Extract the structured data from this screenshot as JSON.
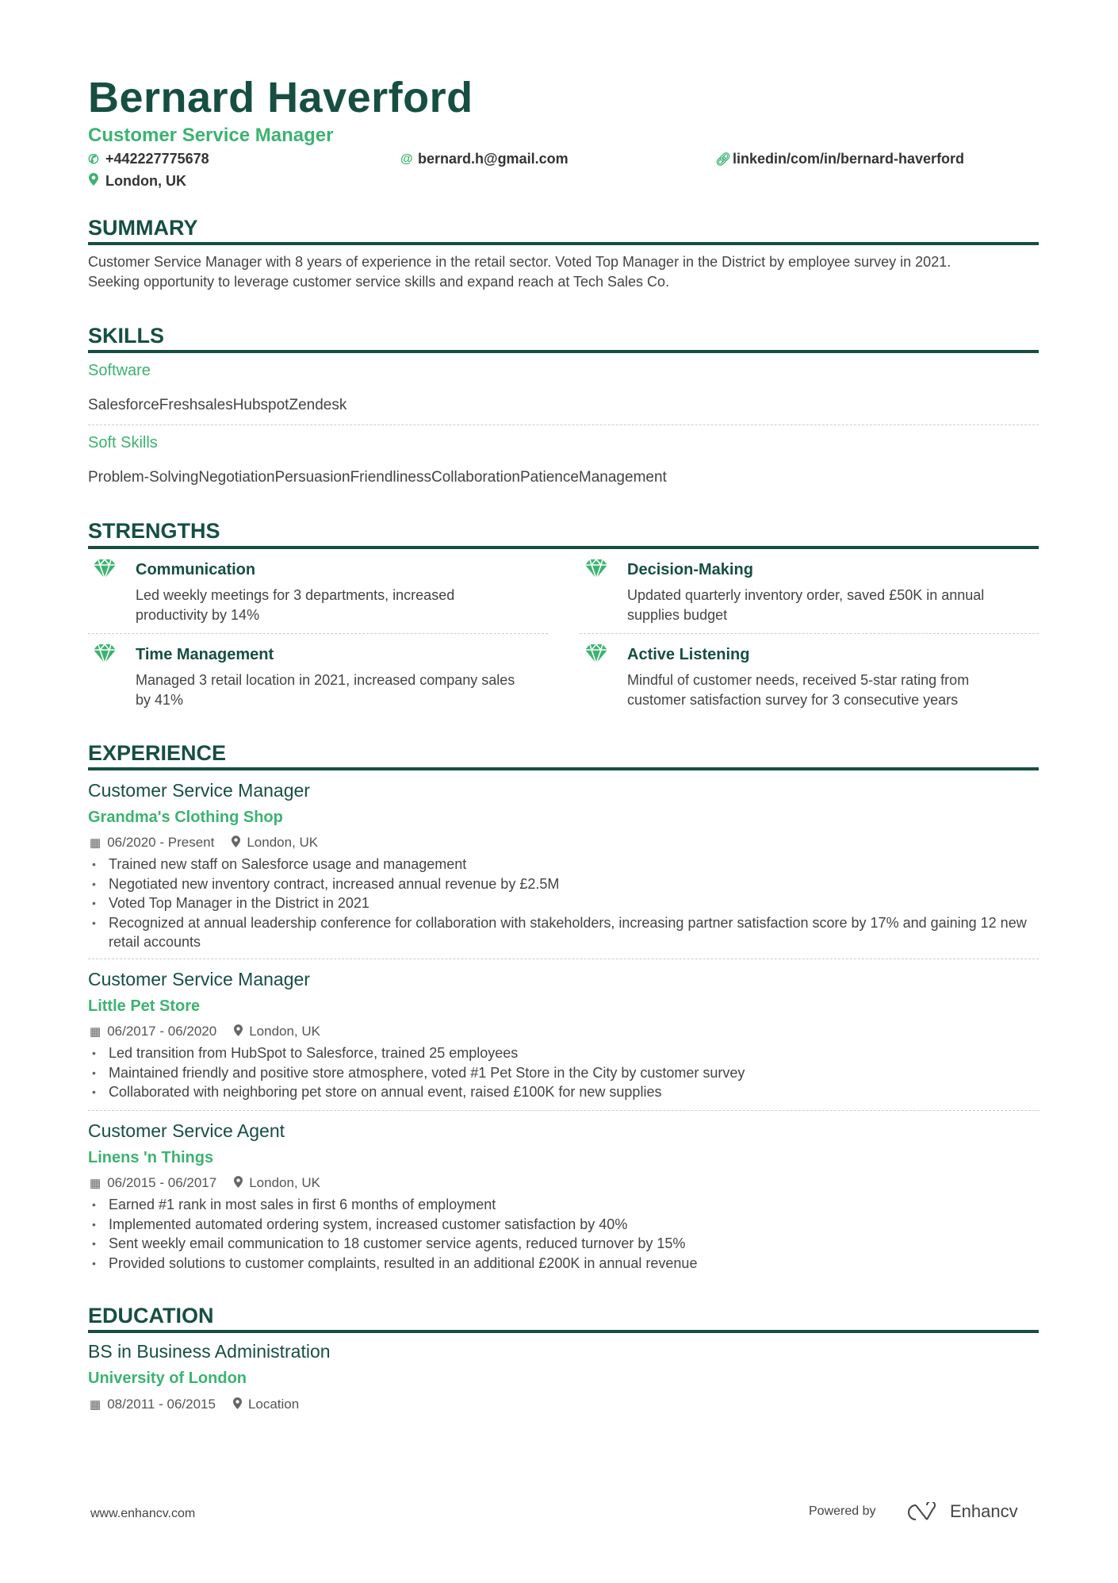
{
  "header": {
    "name": "Bernard Haverford",
    "title": "Customer Service Manager",
    "phone": "+442227775678",
    "email": "bernard.h@gmail.com",
    "linkedin": "linkedin/com/in/bernard-haverford",
    "location": "London, UK"
  },
  "summary": {
    "title": "SUMMARY",
    "line1": "Customer Service Manager with 8 years of experience in the retail sector. Voted Top Manager in the District by employee survey in 2021.",
    "line2": "Seeking opportunity to leverage customer service skills and expand reach at Tech Sales Co."
  },
  "skills": {
    "title": "SKILLS",
    "groups": [
      {
        "name": "Software",
        "items": "SalesforceFreshsalesHubspotZendesk"
      },
      {
        "name": "Soft Skills",
        "items": "Problem-SolvingNegotiationPersuasionFriendlinessCollaborationPatienceManagement"
      }
    ]
  },
  "strengths": {
    "title": "STRENGTHS",
    "items": [
      {
        "title": "Communication",
        "desc1": "Led weekly meetings for 3 departments, increased",
        "desc2": "productivity by 14%"
      },
      {
        "title": "Decision-Making",
        "desc1": "Updated quarterly inventory order, saved £50K in annual",
        "desc2": "supplies budget"
      },
      {
        "title": "Time Management",
        "desc1": "Managed 3 retail location in 2021, increased company sales",
        "desc2": "by 41%"
      },
      {
        "title": "Active Listening",
        "desc1": "Mindful of customer needs, received 5-star rating from",
        "desc2": "customer satisfaction survey for 3 consecutive years"
      }
    ]
  },
  "experience": {
    "title": "EXPERIENCE",
    "jobs": [
      {
        "title": "Customer Service Manager",
        "company": "Grandma's Clothing Shop",
        "dates": "06/2020 - Present",
        "location": "London, UK",
        "bullets": [
          "Trained new staff on Salesforce usage and management",
          "Negotiated new inventory contract, increased annual revenue by £2.5M",
          "Voted Top Manager in the District in 2021",
          "Recognized at annual leadership conference for collaboration with stakeholders, increasing partner satisfaction score by 17% and gaining 12 new retail accounts"
        ]
      },
      {
        "title": "Customer Service Manager",
        "company": "Little Pet Store",
        "dates": "06/2017 - 06/2020",
        "location": "London, UK",
        "bullets": [
          "Led transition from HubSpot to Salesforce, trained 25 employees",
          "Maintained friendly and positive store atmosphere, voted #1 Pet Store in the City by customer survey",
          "Collaborated with neighboring pet store on annual event, raised £100K for new supplies"
        ]
      },
      {
        "title": "Customer Service Agent",
        "company": "Linens 'n Things",
        "dates": "06/2015 - 06/2017",
        "location": "London, UK",
        "bullets": [
          "Earned #1 rank in most sales in first 6 months of employment",
          "Implemented automated ordering system, increased customer satisfaction by 40%",
          "Sent weekly email communication to 18 customer service agents, reduced turnover by 15%",
          "Provided solutions to customer complaints, resulted in an additional £200K in annual revenue"
        ]
      }
    ]
  },
  "education": {
    "title": "EDUCATION",
    "degree": "BS in Business Administration",
    "school": "University of London",
    "dates": "08/2011 - 06/2015",
    "location": "Location"
  },
  "footer": {
    "website": "www.enhancv.com",
    "powered_by": "Powered by",
    "brand": "Enhancv"
  },
  "colors": {
    "primary": "#164f42",
    "accent": "#3cb371"
  }
}
